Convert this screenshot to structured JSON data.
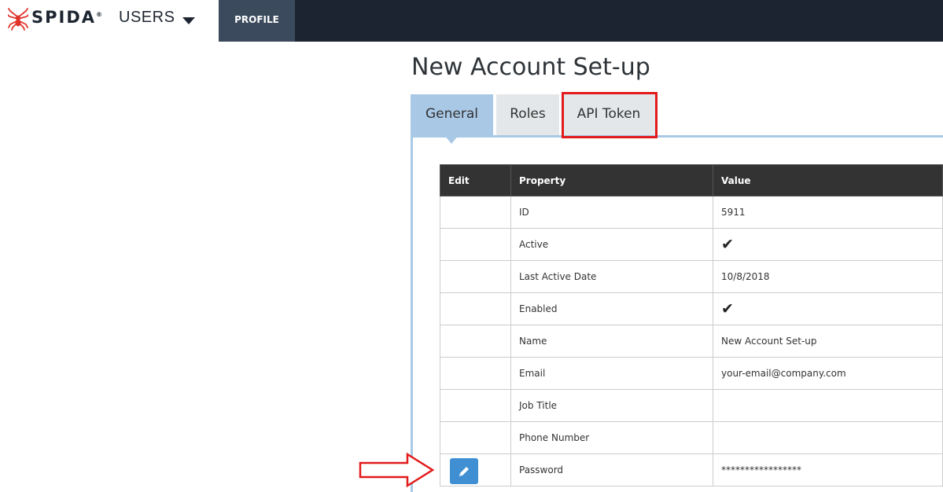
{
  "brand": {
    "name": "SPIDA",
    "registered": "®",
    "product": "USERS"
  },
  "nav": {
    "profile_label": "PROFILE"
  },
  "page": {
    "title": "New Account Set-up"
  },
  "tabs": [
    {
      "label": "General",
      "active": true
    },
    {
      "label": "Roles",
      "active": false
    },
    {
      "label": "API Token",
      "active": false
    }
  ],
  "table": {
    "headers": {
      "edit": "Edit",
      "property": "Property",
      "value": "Value"
    },
    "rows": [
      {
        "property": "ID",
        "value": "5911"
      },
      {
        "property": "Active",
        "value": "✔"
      },
      {
        "property": "Last Active Date",
        "value": "10/8/2018"
      },
      {
        "property": "Enabled",
        "value": "✔"
      },
      {
        "property": "Name",
        "value": "New Account Set-up"
      },
      {
        "property": "Email",
        "value": "your-email@company.com"
      },
      {
        "property": "Job Title",
        "value": ""
      },
      {
        "property": "Phone Number",
        "value": ""
      },
      {
        "property": "Password",
        "value": "*****************"
      }
    ]
  },
  "colors": {
    "topbar": "#1b2430",
    "active_tab": "#a9c8e6",
    "edit_button": "#3f8fd2",
    "annotation": "#e21b1b"
  },
  "icons": {
    "logo": "spider-icon",
    "dropdown": "caret-down-icon",
    "edit": "pencil-icon",
    "check": "checkmark-icon"
  }
}
